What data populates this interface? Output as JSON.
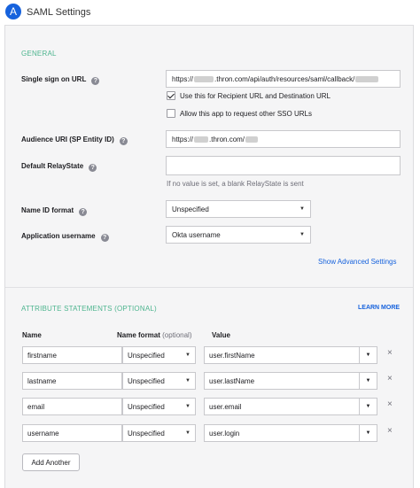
{
  "header": {
    "step": "A",
    "title": "SAML Settings"
  },
  "general": {
    "section_title": "GENERAL",
    "sso_url": {
      "label": "Single sign on URL",
      "value_prefix": "https://",
      "value_mid": ".thron.com/api/auth/resources/saml/callback/"
    },
    "recipient_checkbox": {
      "label": "Use this for Recipient URL and Destination URL",
      "checked": true
    },
    "other_sso_checkbox": {
      "label": "Allow this app to request other SSO URLs",
      "checked": false
    },
    "audience_uri": {
      "label": "Audience URI (SP Entity ID)",
      "value_prefix": "https://",
      "value_mid": ".thron.com/"
    },
    "relay_state": {
      "label": "Default RelayState",
      "value": "",
      "hint": "If no value is set, a blank RelayState is sent"
    },
    "name_id_format": {
      "label": "Name ID format",
      "value": "Unspecified"
    },
    "app_username": {
      "label": "Application username",
      "value": "Okta username"
    },
    "advanced_link": "Show Advanced Settings"
  },
  "attributes": {
    "section_title": "ATTRIBUTE STATEMENTS (OPTIONAL)",
    "learn_more": "LEARN MORE",
    "col_name": "Name",
    "col_format": "Name format",
    "col_format_opt": "(optional)",
    "col_value": "Value",
    "rows": [
      {
        "name": "firstname",
        "format": "Unspecified",
        "value": "user.firstName"
      },
      {
        "name": "lastname",
        "format": "Unspecified",
        "value": "user.lastName"
      },
      {
        "name": "email",
        "format": "Unspecified",
        "value": "user.email"
      },
      {
        "name": "username",
        "format": "Unspecified",
        "value": "user.login"
      }
    ],
    "add_button": "Add Another"
  },
  "icons": {
    "help": "?",
    "caret": "▼",
    "remove": "×"
  },
  "colors": {
    "accent_green": "#4eb58f",
    "link_blue": "#1662dd",
    "badge_blue": "#1662dd"
  }
}
